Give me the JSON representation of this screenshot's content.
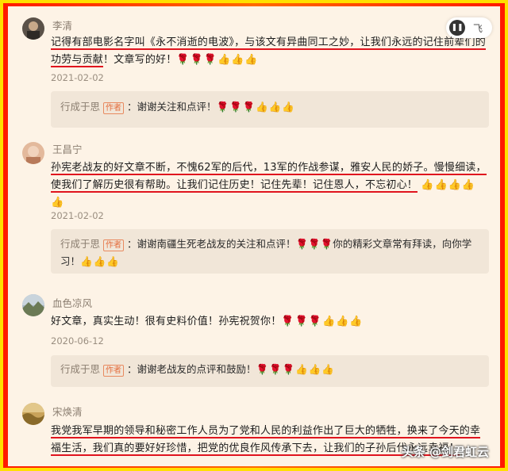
{
  "comments": [
    {
      "user": "李清",
      "text_parts": [
        "记得有部电影名字叫《永不消逝的电波》，与该文有异曲同工之妙，让我们永远的记住前辈们的功劳与贡献",
        "！文章写的好！"
      ],
      "emoji": "🌹🌹🌹👍👍👍",
      "date": "2021-02-02",
      "reply": {
        "author": "行成于思",
        "tag": "作者",
        "text": "：谢谢关注和点评！",
        "emoji": "🌹🌹🌹👍👍👍"
      }
    },
    {
      "user": "王昌宁",
      "text_parts": [
        "孙宪老战友的好文章不断，不愧62军的后代，13军的作战参谋，雅安人民的娇子。慢慢细读，使我们了解历史很有帮助。让我们记住历史！记住先辈！记住恩人，不忘初心！",
        ""
      ],
      "emoji": "👍👍👍👍👍",
      "date": "2021-02-02",
      "reply": {
        "author": "行成于思",
        "tag": "作者",
        "text": "：谢谢南疆生死老战友的关注和点评！🌹🌹🌹你的精彩文章常有拜读，向你学习！",
        "emoji": "👍👍👍"
      }
    },
    {
      "user": "血色凉风",
      "text_parts": [
        "",
        "好文章，真实生动！很有史料价值！孙宪祝贺你！"
      ],
      "emoji": "🌹🌹🌹👍👍👍",
      "date": "2020-06-12",
      "reply": {
        "author": "行成于思",
        "tag": "作者",
        "text": "：谢谢老战友的点评和鼓励！",
        "emoji": "🌹🌹🌹👍👍👍"
      }
    },
    {
      "user": "宋焕清",
      "text_parts": [
        "我党我军早期的领导和秘密工作人员为了党和人民的利益作出了巨大的牺牲，换来了今天的幸福生活，我们真的要好好珍惜，把党的优良作风传承下去，让我们的子孙后代永远幸福！",
        ""
      ],
      "emoji": "",
      "date": "2020-06-12",
      "reply": null
    }
  ],
  "float_button": {
    "label": "飞"
  },
  "watermark": "头条 @剑君虹云",
  "colors": {
    "underline": "#e0141e",
    "frame": "#ff3a00",
    "panel": "#fdf3e6"
  }
}
